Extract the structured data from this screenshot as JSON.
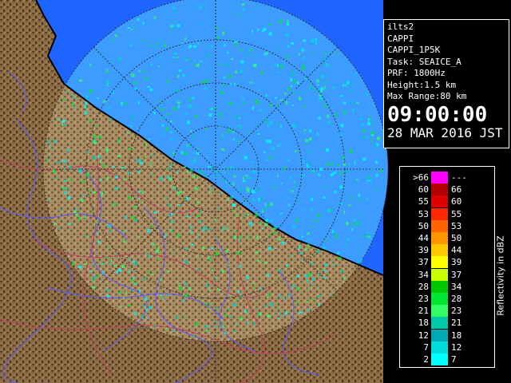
{
  "info": {
    "radar": "ilts2",
    "product": "CAPPI",
    "product_name": "CAPPI_1P5K",
    "task": "Task: SEAICE_A",
    "prf": "PRF: 1800Hz",
    "height": "Height:1.5 km",
    "max_range": "Max Range:80 km",
    "time": "09:00:00",
    "date": "28 MAR 2016 JST"
  },
  "legend": {
    "title": "Reflectivity in dBZ",
    "rows": [
      {
        "lo": ">66",
        "hi": "---",
        "color": "#ff00ff"
      },
      {
        "lo": "60",
        "hi": "66",
        "color": "#b40000"
      },
      {
        "lo": "55",
        "hi": "60",
        "color": "#dc0000"
      },
      {
        "lo": "53",
        "hi": "55",
        "color": "#ff2800"
      },
      {
        "lo": "50",
        "hi": "53",
        "color": "#ff6400"
      },
      {
        "lo": "44",
        "hi": "50",
        "color": "#ff9600"
      },
      {
        "lo": "39",
        "hi": "44",
        "color": "#ffc800"
      },
      {
        "lo": "37",
        "hi": "39",
        "color": "#ffff00"
      },
      {
        "lo": "34",
        "hi": "37",
        "color": "#c8ff00"
      },
      {
        "lo": "28",
        "hi": "34",
        "color": "#00c800"
      },
      {
        "lo": "23",
        "hi": "28",
        "color": "#00e632"
      },
      {
        "lo": "21",
        "hi": "23",
        "color": "#32ff64"
      },
      {
        "lo": "18",
        "hi": "21",
        "color": "#00c8aa"
      },
      {
        "lo": "12",
        "hi": "18",
        "color": "#00aab4"
      },
      {
        "lo": "7",
        "hi": "12",
        "color": "#00dcdc"
      },
      {
        "lo": "2",
        "hi": "7",
        "color": "#00ffff"
      }
    ]
  },
  "colors": {
    "sea": "#1e64ff",
    "sea_in_range": "#3c9cff",
    "land": "#8a6a44",
    "river": "#5a5aff",
    "border": "#c04060"
  }
}
